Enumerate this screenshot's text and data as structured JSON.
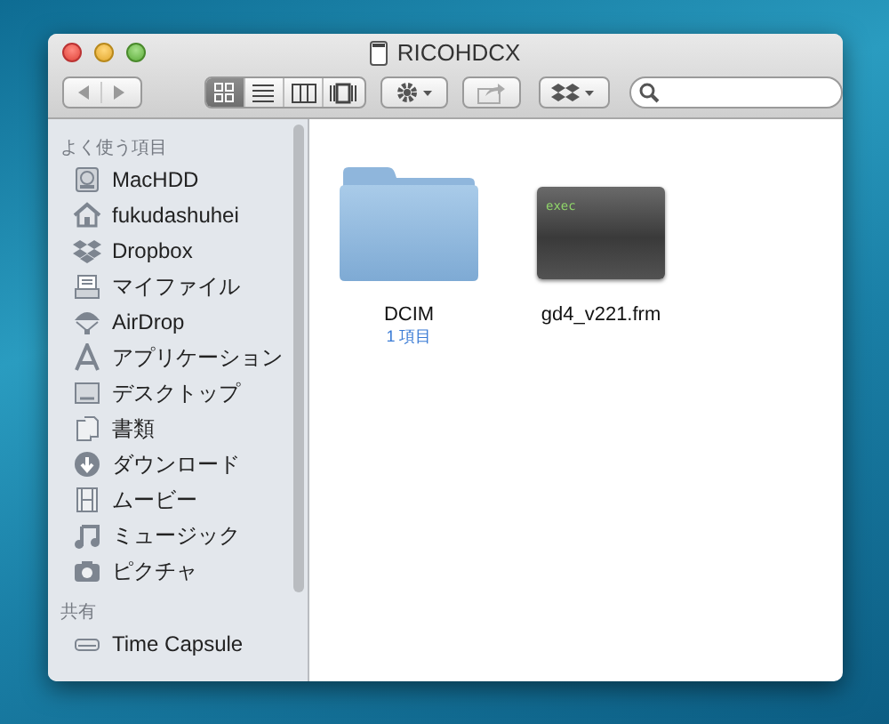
{
  "window": {
    "title": "RICOHDCX"
  },
  "toolbar": {
    "view_modes": [
      {
        "kind": "icons",
        "selected": true
      },
      {
        "kind": "list",
        "selected": false
      },
      {
        "kind": "columns",
        "selected": false
      },
      {
        "kind": "coverflow",
        "selected": false
      }
    ]
  },
  "sidebar": {
    "sections": [
      {
        "title": "よく使う項目",
        "items": [
          {
            "label": "MacHDD",
            "kind": "disk"
          },
          {
            "label": "fukudashuhei",
            "kind": "home"
          },
          {
            "label": "Dropbox",
            "kind": "dropbox"
          },
          {
            "label": "マイファイル",
            "kind": "files"
          },
          {
            "label": "AirDrop",
            "kind": "airdrop"
          },
          {
            "label": "アプリケーション",
            "kind": "apps"
          },
          {
            "label": "デスクトップ",
            "kind": "desktop"
          },
          {
            "label": "書類",
            "kind": "docs"
          },
          {
            "label": "ダウンロード",
            "kind": "download"
          },
          {
            "label": "ムービー",
            "kind": "movie"
          },
          {
            "label": "ミュージック",
            "kind": "music"
          },
          {
            "label": "ピクチャ",
            "kind": "camera"
          }
        ]
      },
      {
        "title": "共有",
        "items": [
          {
            "label": "Time Capsule",
            "kind": "drive"
          }
        ]
      }
    ]
  },
  "files": [
    {
      "kind": "folder",
      "name": "DCIM",
      "info": "1 項目"
    },
    {
      "kind": "exec",
      "name": "gd4_v221.frm",
      "badge": "exec"
    }
  ]
}
